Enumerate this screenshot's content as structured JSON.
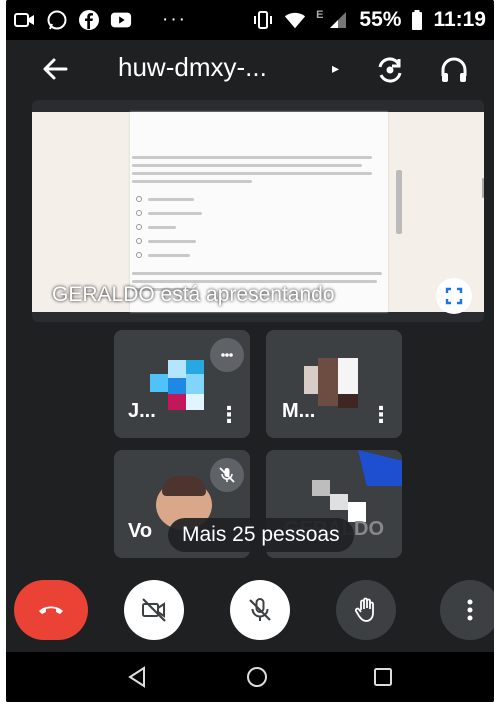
{
  "status_bar": {
    "overflow": "···",
    "network": "E",
    "battery": "55%",
    "time": "11:19"
  },
  "app_bar": {
    "meeting_code": "huw-dmxy-...",
    "caret": "▸"
  },
  "presentation": {
    "presenter_label": "GERALDO está apresentando"
  },
  "participants": [
    {
      "name": "J...",
      "muted": false
    },
    {
      "name": "M...",
      "muted": false
    },
    {
      "name": "Vo",
      "muted": true
    },
    {
      "name": "GERALDO",
      "muted": false
    }
  ],
  "more_people": "Mais 25 pessoas",
  "colors": {
    "end_call": "#ea4335",
    "background": "#1f2022",
    "tile": "#3c4043",
    "control_white": "#ffffff",
    "control_dark": "#3c4043"
  }
}
